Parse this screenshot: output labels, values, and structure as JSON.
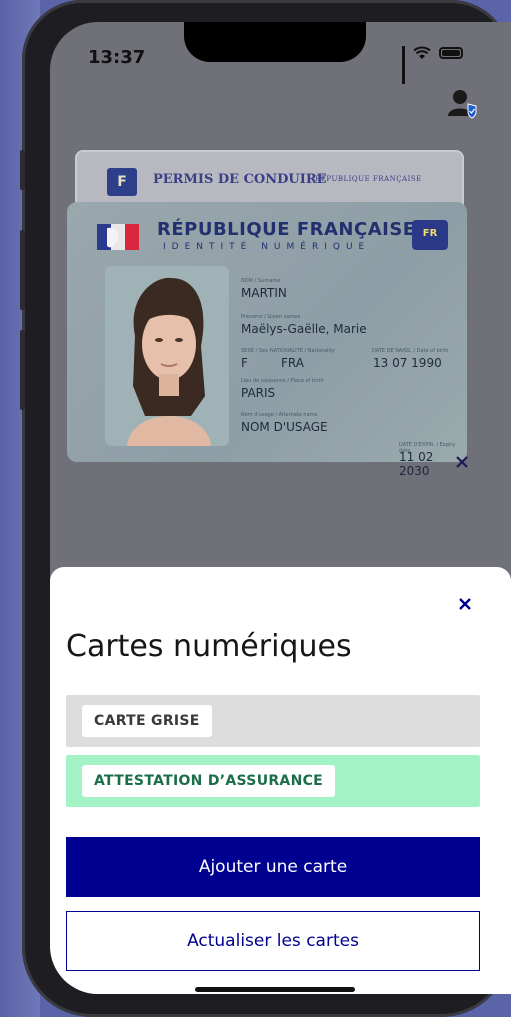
{
  "status_bar": {
    "time": "13:37"
  },
  "permis": {
    "flag_letter": "F",
    "title": "PERMIS DE CONDUIRE",
    "subtitle": "RÉPUBLIQUE FRANÇAISE"
  },
  "id_card": {
    "title": "RÉPUBLIQUE FRANÇAISE",
    "subtitle": "IDENTITÉ NUMÉRIQUE",
    "eu_code": "FR",
    "fields": {
      "nom_label": "NOM / Surname",
      "nom": "MARTIN",
      "prenoms_label": "Prénoms / Given names",
      "prenoms": "Maëlys-Gaëlle, Marie",
      "sexe_label": "SEXE / Sex",
      "sexe": "F",
      "nationalite_label": "NATIONALITÉ / Nationality",
      "nationalite": "FRA",
      "naissance_label": "DATE DE NAISS. / Date of birth",
      "naissance": "13 07 1990",
      "lieu_label": "Lieu de naissance / Place of birth",
      "lieu": "PARIS",
      "usage_label": "Nom d'usage / Alternate name",
      "usage": "NOM D'USAGE",
      "expiry_label": "DATE D'EXPIR. / Expiry date",
      "expiry": "11 02 2030"
    }
  },
  "sheet": {
    "title": "Cartes numériques",
    "cards": [
      {
        "label": "CARTE GRISE"
      },
      {
        "label": "ATTESTATION D’ASSURANCE"
      }
    ],
    "add_button": "Ajouter une carte",
    "refresh_button": "Actualiser les cartes"
  },
  "colors": {
    "primary": "#000091",
    "assurance_bg": "#a3f3c6",
    "grise_bg": "#dddddd"
  }
}
